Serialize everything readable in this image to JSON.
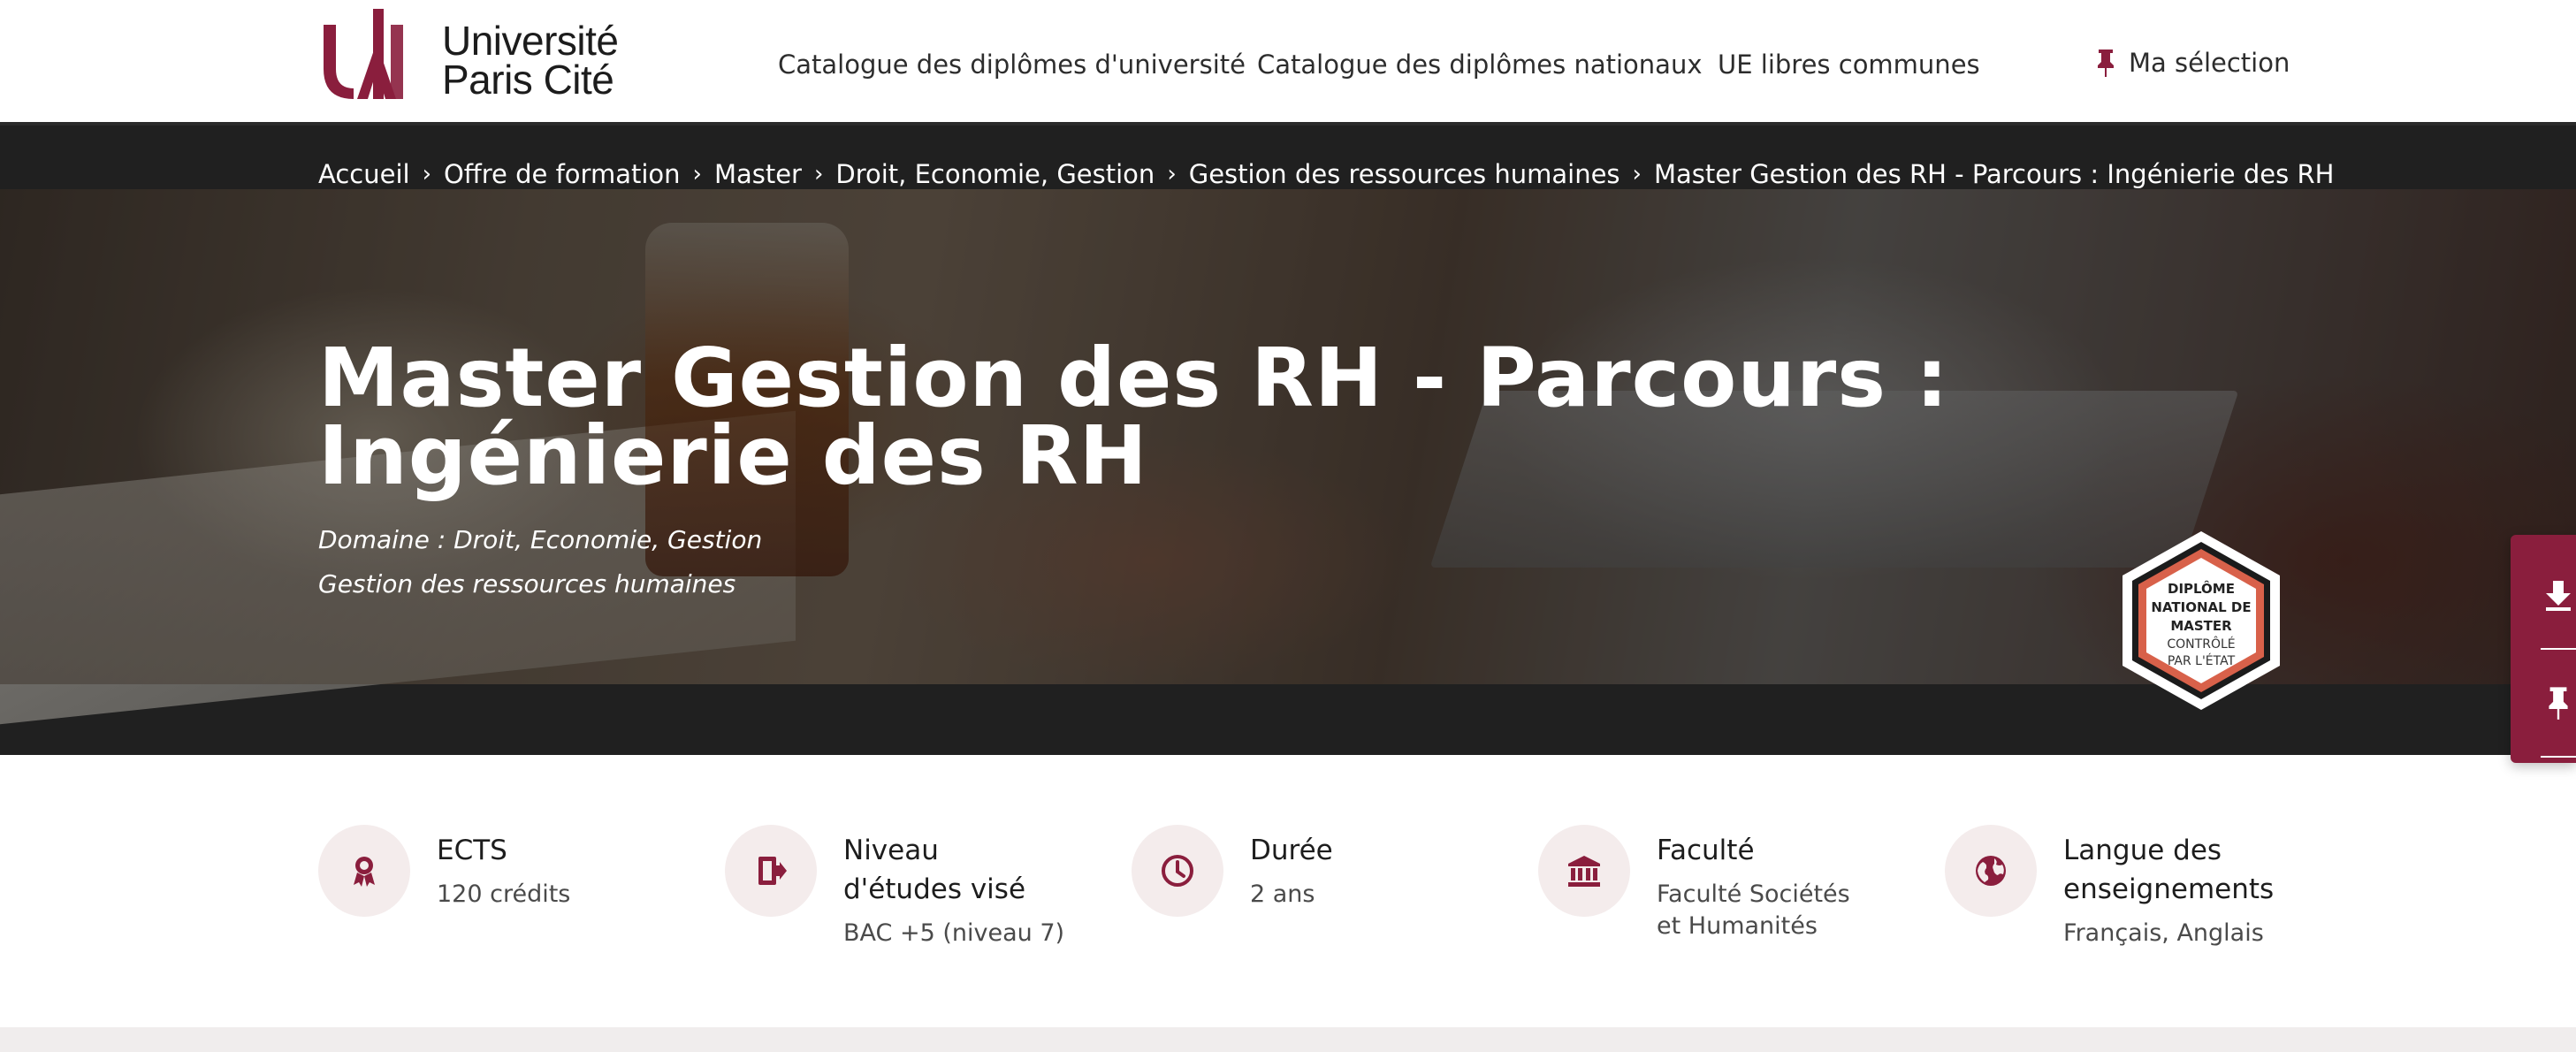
{
  "header": {
    "logo_line1": "Université",
    "logo_line2": "Paris Cité",
    "nav": [
      {
        "label": "Catalogue des diplômes d'université"
      },
      {
        "label": "Catalogue des diplômes nationaux"
      },
      {
        "label": "UE libres communes"
      }
    ],
    "selection_label": "Ma sélection"
  },
  "breadcrumb": [
    {
      "label": "Accueil"
    },
    {
      "label": "Offre de formation"
    },
    {
      "label": "Master"
    },
    {
      "label": "Droit, Economie, Gestion"
    },
    {
      "label": "Gestion des ressources humaines"
    },
    {
      "label": "Master Gestion des RH - Parcours : Ingénierie des RH"
    }
  ],
  "hero": {
    "title": "Master Gestion des RH - Parcours : Ingénierie des RH",
    "domain": "Domaine : Droit, Economie, Gestion",
    "mention": "Gestion des ressources humaines",
    "badge": {
      "line1": "DIPLÔME",
      "line2": "NATIONAL DE",
      "line3": "MASTER",
      "line4": "CONTRÔLÉ",
      "line5": "PAR L'ÉTAT"
    }
  },
  "info": [
    {
      "label": "ECTS",
      "value": "120 crédits",
      "icon": "award-icon"
    },
    {
      "label_line1": "Niveau",
      "label_line2": "d'études visé",
      "value": "BAC +5 (niveau 7)",
      "icon": "door-exit-icon"
    },
    {
      "label": "Durée",
      "value": "2 ans",
      "icon": "clock-icon"
    },
    {
      "label": "Faculté",
      "value_line1": "Faculté Sociétés",
      "value_line2": "et Humanités",
      "icon": "institution-icon"
    },
    {
      "label_line1": "Langue des",
      "label_line2": "enseignements",
      "value": "Français, Anglais",
      "icon": "globe-icon"
    }
  ],
  "colors": {
    "brand": "#8a1e3d",
    "hero_dark": "#202020",
    "icon_bg": "#f4ecec"
  }
}
